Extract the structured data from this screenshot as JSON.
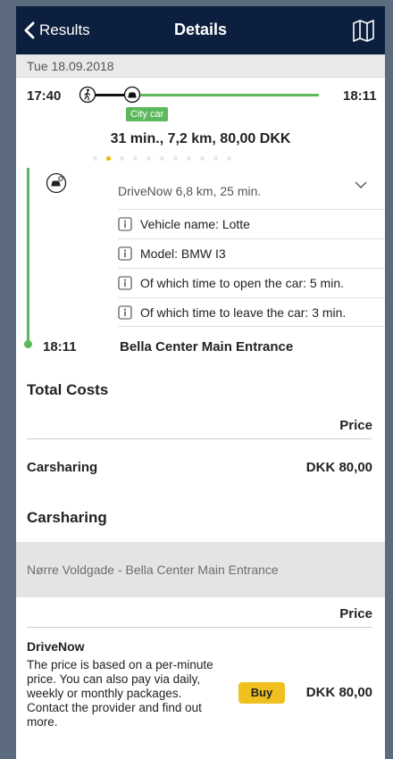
{
  "navbar": {
    "back_label": "Results",
    "title": "Details"
  },
  "date": "Tue 18.09.2018",
  "trip": {
    "departure": "17:40",
    "arrival": "18:11",
    "mode_badge": "City car",
    "summary": "31 min., 7,2 km, 80,00 DKK",
    "page_dots": 11,
    "active_dot": 1
  },
  "leg": {
    "provider_line": "DriveNow 6,8 km, 25 min.",
    "details": [
      "Vehicle name: Lotte",
      "Model: BMW I3",
      "Of which time to open the car: 5 min.",
      "Of which time to leave the car: 3 min."
    ],
    "arrival_time": "18:11",
    "arrival_place": "Bella Center Main Entrance"
  },
  "costs": {
    "heading": "Total Costs",
    "price_header": "Price",
    "row_label": "Carsharing",
    "row_value": "DKK 80,00"
  },
  "carsharing": {
    "heading": "Carsharing",
    "route": "Nørre Voldgade - Bella Center Main Entrance",
    "price_header": "Price",
    "provider": "DriveNow",
    "description": "The price is based on a per-minute price. You can also pay via daily, weekly or monthly packages. Contact the provider and find out more.",
    "buy_label": "Buy",
    "price": "DKK 80,00"
  },
  "colors": {
    "navbar": "#0c1f3e",
    "accent_green": "#5cb85c",
    "buy_yellow": "#f0c020",
    "active_dot": "#f0b400"
  }
}
